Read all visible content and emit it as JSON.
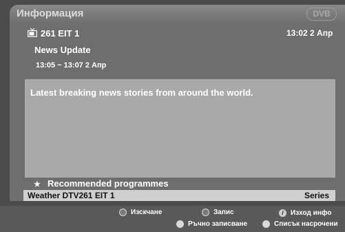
{
  "header": {
    "title": "Информация",
    "logo_text": "DVB"
  },
  "channel": {
    "icon": "tv-icon",
    "name": "261 EIT 1",
    "clock": "13:02 2 Апр"
  },
  "programme": {
    "title": "News Update",
    "time": "13:05 ~ 13:07 2 Апр"
  },
  "description": "Latest breaking news stories from around the world.",
  "recommended": {
    "label": "Recommended programmes",
    "icon": "star-icon"
  },
  "selected_item": {
    "name": "Weather DTV261 EIT 1",
    "genre": "Series"
  },
  "footer": {
    "buttons": [
      {
        "label": "Изскчане",
        "icon": "ring-icon"
      },
      {
        "label": "Запис",
        "icon": "ring-icon"
      },
      {
        "label": "Изход инфо",
        "icon": "info-icon"
      },
      {
        "label": "Ръчно записване",
        "icon": "dot-icon"
      },
      {
        "label": "Списък насрочени",
        "icon": "dot-icon"
      }
    ]
  },
  "colors": {
    "panel": "#6e6e6e",
    "description_bg": "#a9a9a9",
    "selection_bg": "#cfcfcf",
    "footer": "#595959"
  }
}
